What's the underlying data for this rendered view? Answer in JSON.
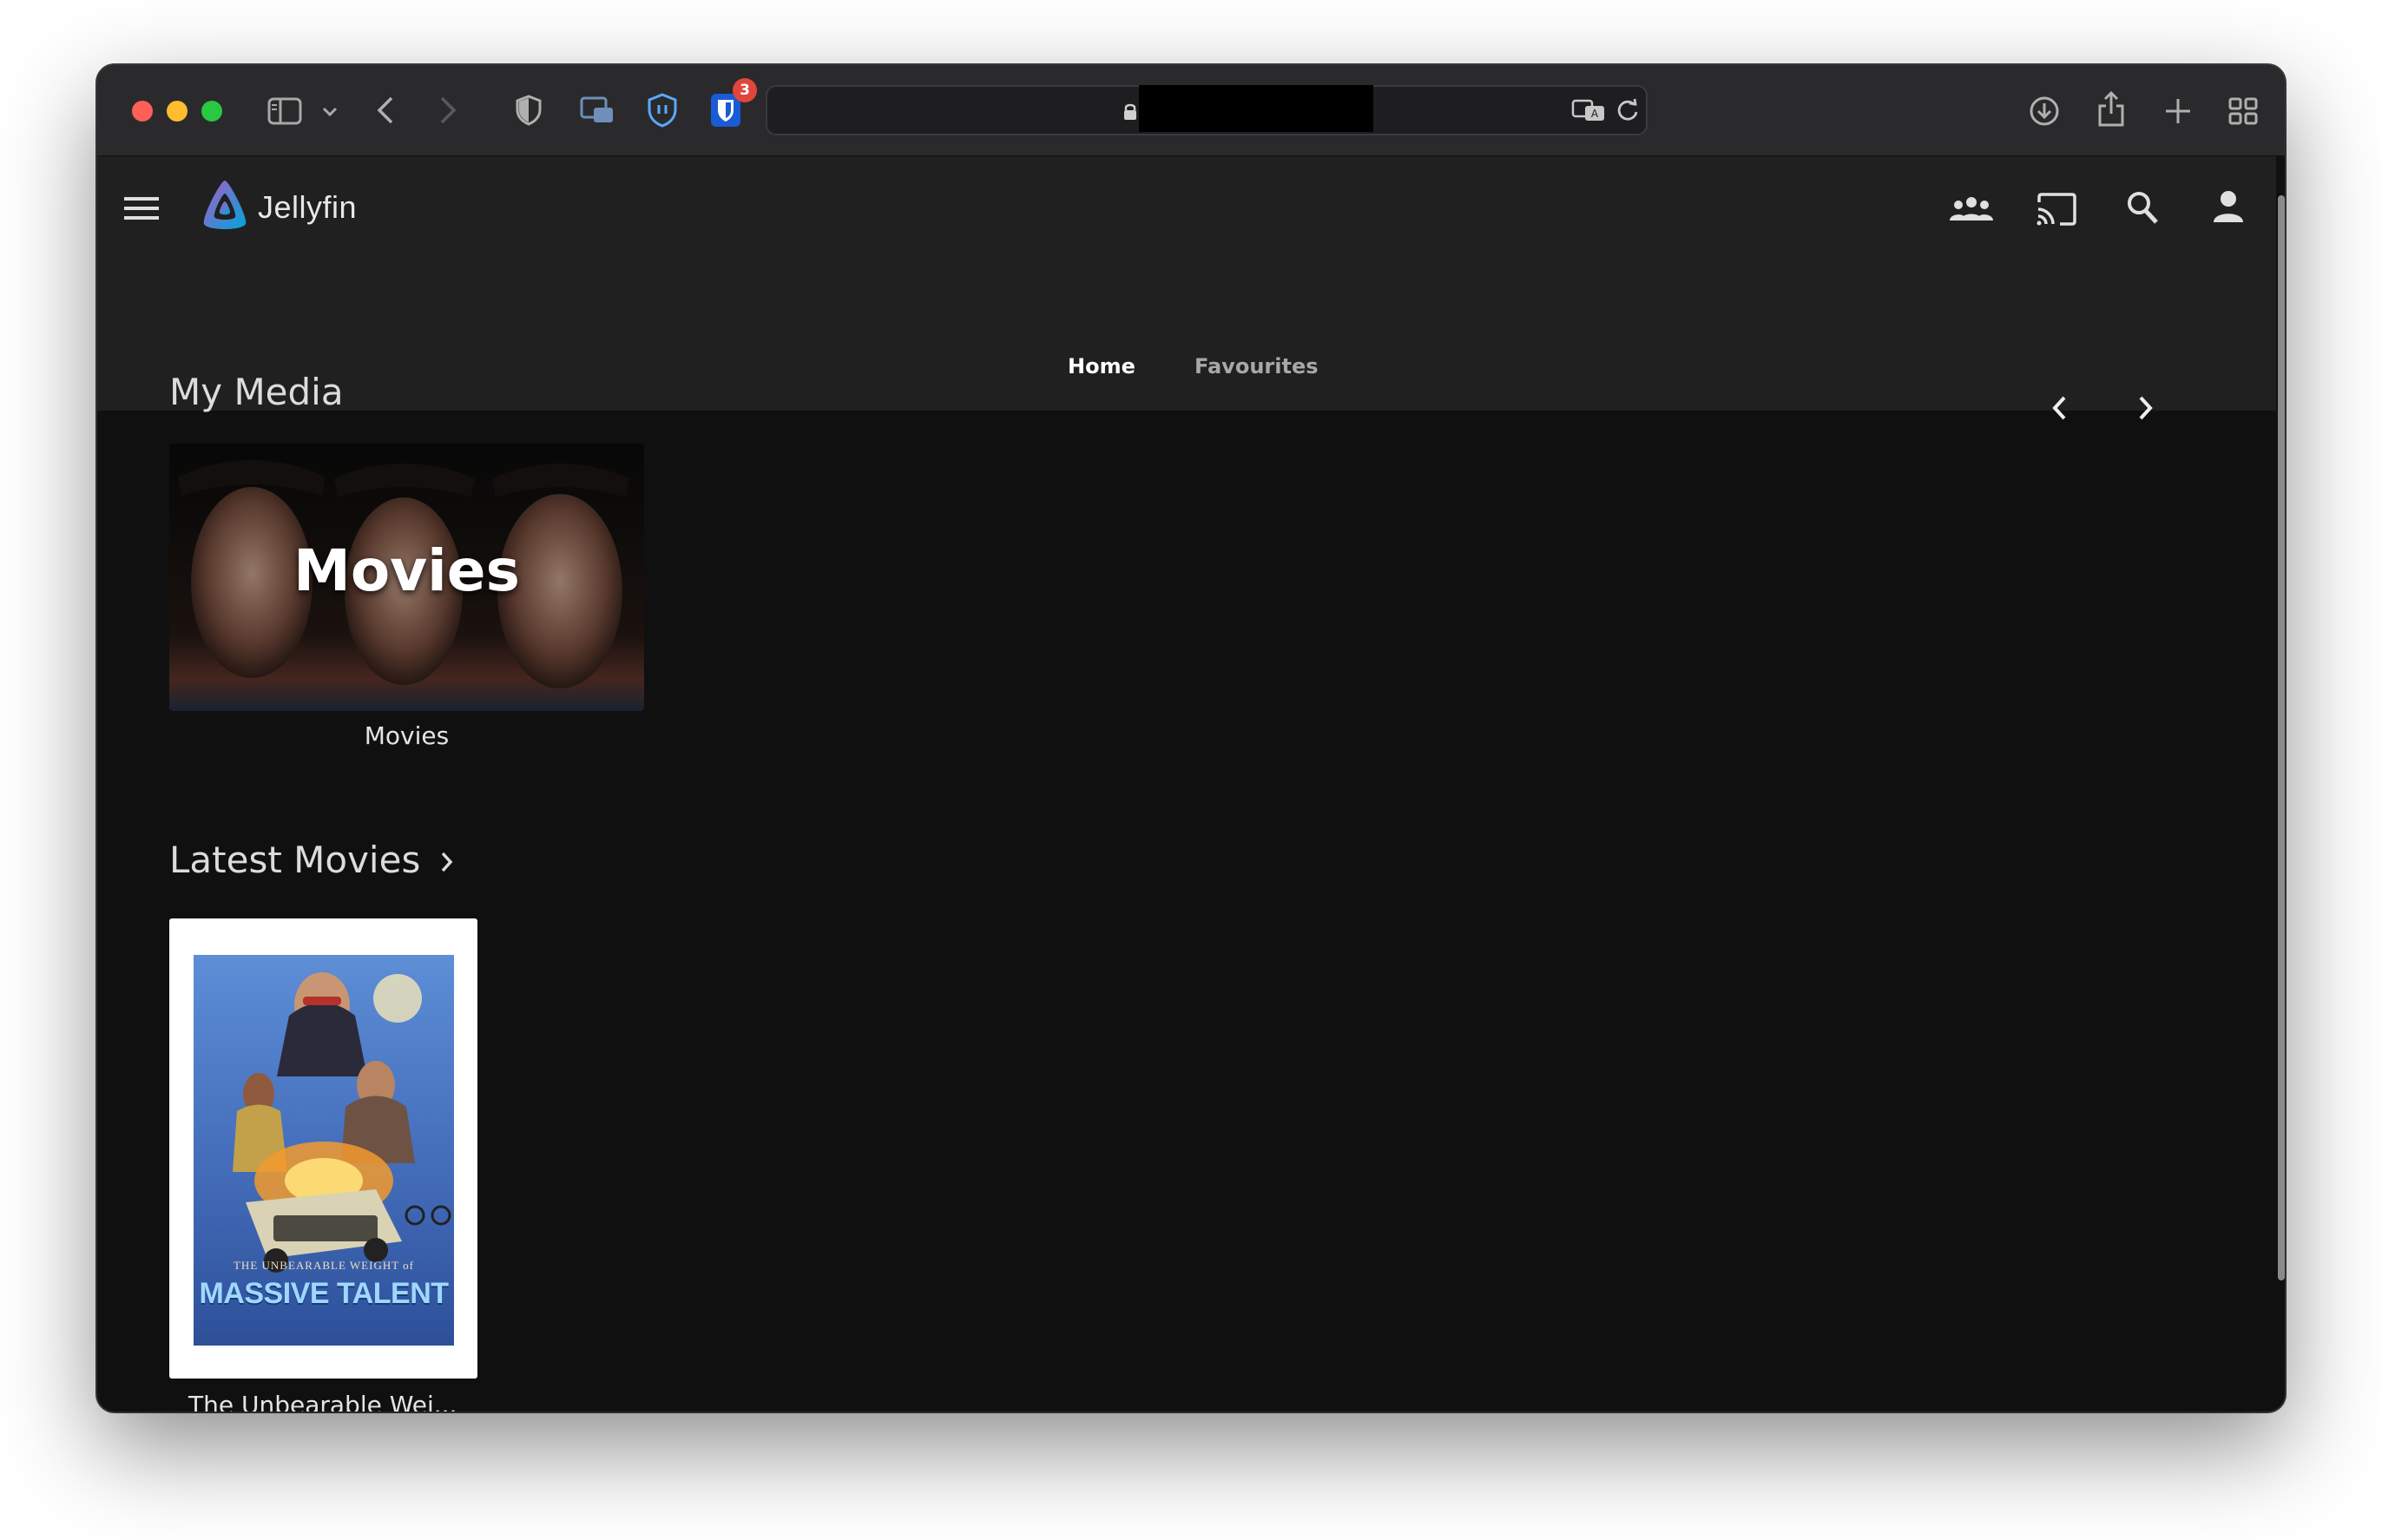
{
  "browser": {
    "extension_badge_count": "3",
    "url": ""
  },
  "app": {
    "brand_name": "Jellyfin",
    "tabs": [
      {
        "label": "Home",
        "active": true
      },
      {
        "label": "Favourites",
        "active": false
      }
    ]
  },
  "my_media": {
    "title": "My Media",
    "items": [
      {
        "overlay_title": "Movies",
        "caption": "Movies"
      }
    ]
  },
  "latest_movies": {
    "title": "Latest Movies",
    "items": [
      {
        "poster_subtitle": "THE UNBEARABLE WEIGHT of",
        "poster_title": "MASSIVE TALENT",
        "caption": "The Unbearable Wei..."
      }
    ]
  },
  "colors": {
    "header_bg": "#202020",
    "content_bg": "#101010",
    "accent_purple": "#aa5cc3",
    "accent_blue": "#00a4dc"
  },
  "icons": [
    "menu-icon",
    "jellyfin-logo-icon",
    "users-icon",
    "cast-icon",
    "search-icon",
    "user-icon",
    "chevron-left-icon",
    "chevron-right-icon"
  ]
}
